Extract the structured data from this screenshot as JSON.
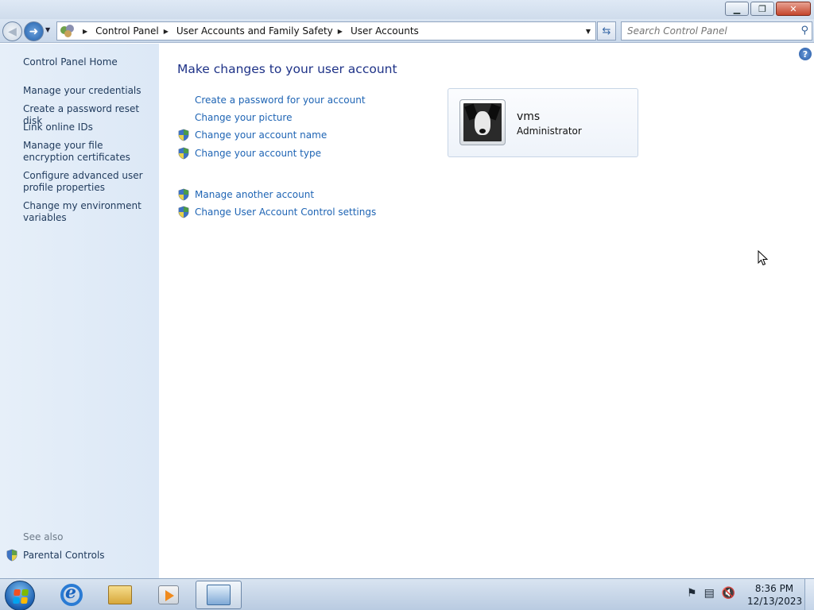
{
  "window": {
    "minimize_icon": "minimize-icon",
    "restore_icon": "restore-icon",
    "close_icon": "close-icon"
  },
  "address_bar": {
    "breadcrumbs": [
      "Control Panel",
      "User Accounts and Family Safety",
      "User Accounts"
    ],
    "search_placeholder": "Search Control Panel"
  },
  "left_pane": {
    "home_link": "Control Panel Home",
    "links": [
      "Manage your credentials",
      "Create a password reset disk",
      "Link online IDs",
      "Manage your file encryption certificates",
      "Configure advanced user profile properties",
      "Change my environment variables"
    ],
    "see_also_label": "See also",
    "see_also_links": [
      "Parental Controls"
    ]
  },
  "main": {
    "title": "Make changes to your user account",
    "tasks_group1": [
      {
        "label": "Create a password for your account",
        "shield": false
      },
      {
        "label": "Change your picture",
        "shield": false
      },
      {
        "label": "Change your account name",
        "shield": true
      },
      {
        "label": "Change your account type",
        "shield": true
      }
    ],
    "tasks_group2": [
      {
        "label": "Manage another account",
        "shield": true
      },
      {
        "label": "Change User Account Control settings",
        "shield": true
      }
    ],
    "account": {
      "name": "vms",
      "role": "Administrator"
    }
  },
  "taskbar": {
    "time": "8:36 PM",
    "date": "12/13/2023",
    "pinned": [
      "internet-explorer",
      "windows-explorer",
      "windows-media-player",
      "control-panel"
    ],
    "tray_icons": [
      "action-center-flag-icon",
      "network-icon",
      "volume-muted-icon"
    ]
  },
  "colors": {
    "link": "#1e64b4",
    "heading": "#1e3287",
    "left_pane_bg": "#dce8f6"
  }
}
